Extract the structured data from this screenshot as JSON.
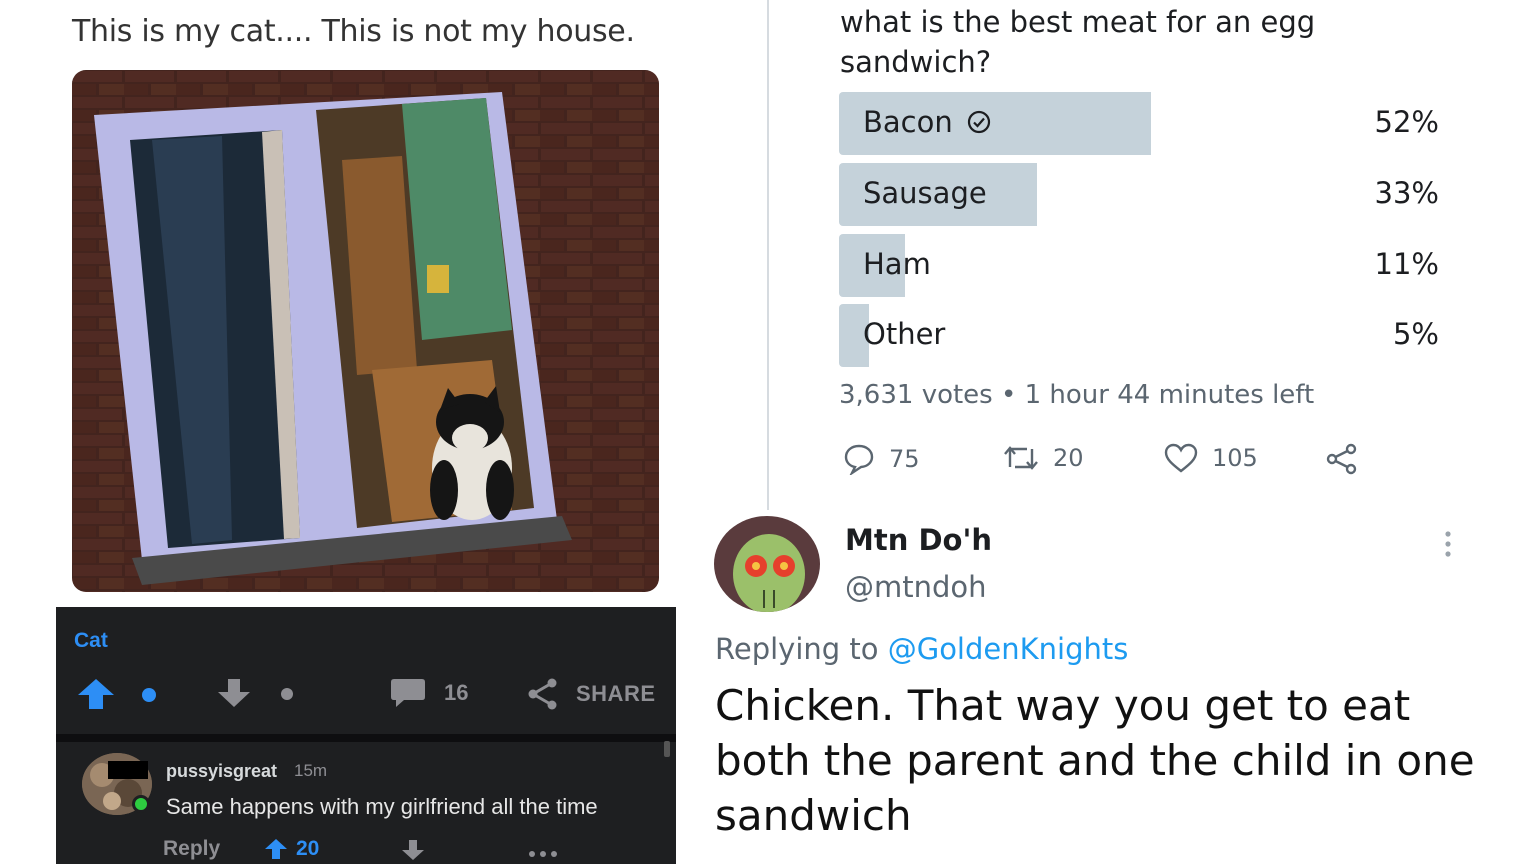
{
  "left_post": {
    "caption": "This is my cat.... This is not my house.",
    "subreddit": "Cat",
    "comment_count": "16",
    "share_label": "SHARE"
  },
  "comment": {
    "username": "pussyisgreat",
    "time": "15m",
    "body": "Same happens with my girlfriend all the time",
    "reply_label": "Reply",
    "score": "20"
  },
  "poll": {
    "question": "what is the best meat for an egg sandwich?",
    "options": [
      {
        "label": "Bacon",
        "percent_text": "52%",
        "percent": 52,
        "selected": true
      },
      {
        "label": "Sausage",
        "percent_text": "33%",
        "percent": 33,
        "selected": false
      },
      {
        "label": "Ham",
        "percent_text": "11%",
        "percent": 11,
        "selected": false
      },
      {
        "label": "Other",
        "percent_text": "5%",
        "percent": 5,
        "selected": false
      }
    ],
    "meta": "3,631 votes • 1 hour 44 minutes left",
    "actions": {
      "replies": "75",
      "retweets": "20",
      "likes": "105"
    }
  },
  "reply_tweet": {
    "display_name": "Mtn Do'h",
    "handle": "@mtndoh",
    "replying_prefix": "Replying to",
    "replying_to": "@GoldenKnights",
    "body": "Chicken. That way you get to eat both the parent and the child in one sandwich"
  },
  "colors": {
    "reddit_accent": "#2d8ef5",
    "poll_fill": "#c5d2da",
    "twitter_link": "#1d9bf0"
  }
}
